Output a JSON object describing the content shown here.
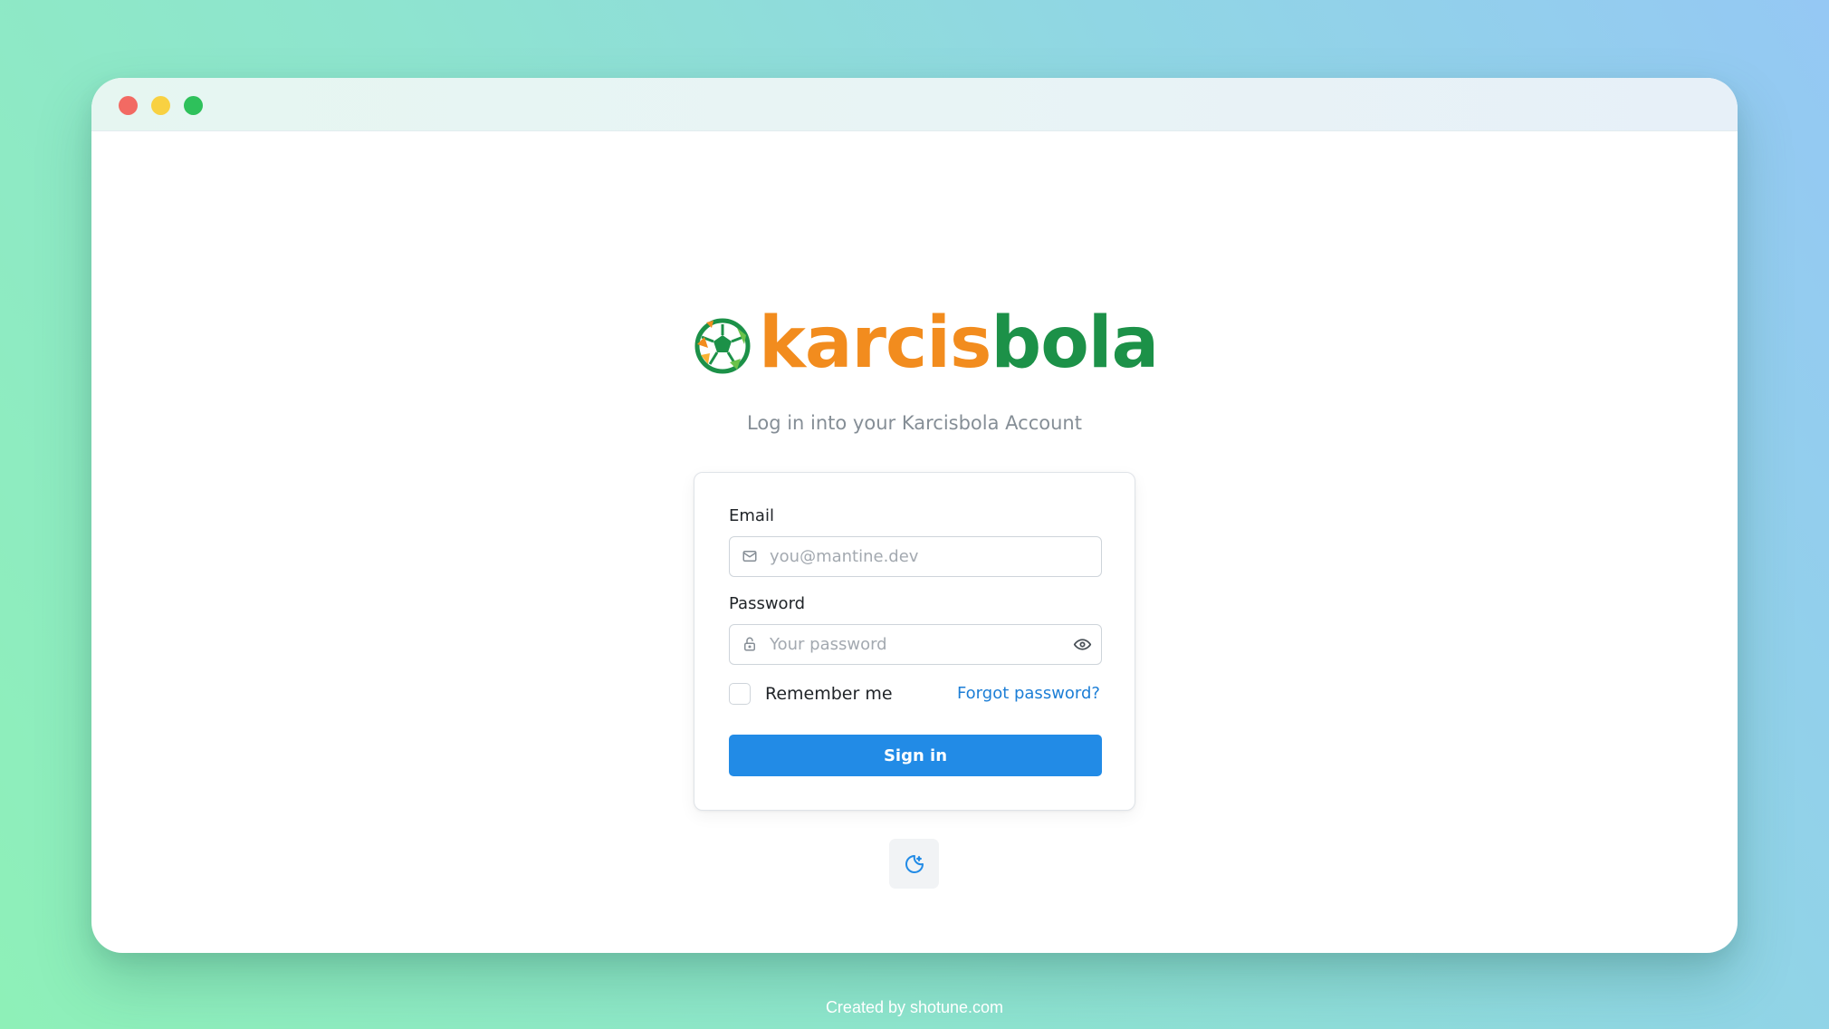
{
  "window": {
    "controls": [
      "close",
      "minimize",
      "maximize"
    ]
  },
  "brand": {
    "name_part1": "karcis",
    "name_part2": "bola",
    "logo_icon": "soccer-ball-icon",
    "colors": {
      "orange": "#f28c1e",
      "green": "#1c9148"
    }
  },
  "login": {
    "subtitle": "Log in into your Karcisbola Account",
    "email_label": "Email",
    "email_placeholder": "you@mantine.dev",
    "email_value": "",
    "email_icon": "mail-icon",
    "password_label": "Password",
    "password_placeholder": "Your password",
    "password_value": "",
    "password_icon": "lock-icon",
    "password_toggle_icon": "eye-icon",
    "remember_label": "Remember me",
    "remember_checked": false,
    "forgot_label": "Forgot password?",
    "submit_label": "Sign in",
    "accent_color": "#228be6"
  },
  "theme_toggle": {
    "icon": "moon-icon"
  },
  "footer": {
    "credit": "Created by shotune.com"
  }
}
